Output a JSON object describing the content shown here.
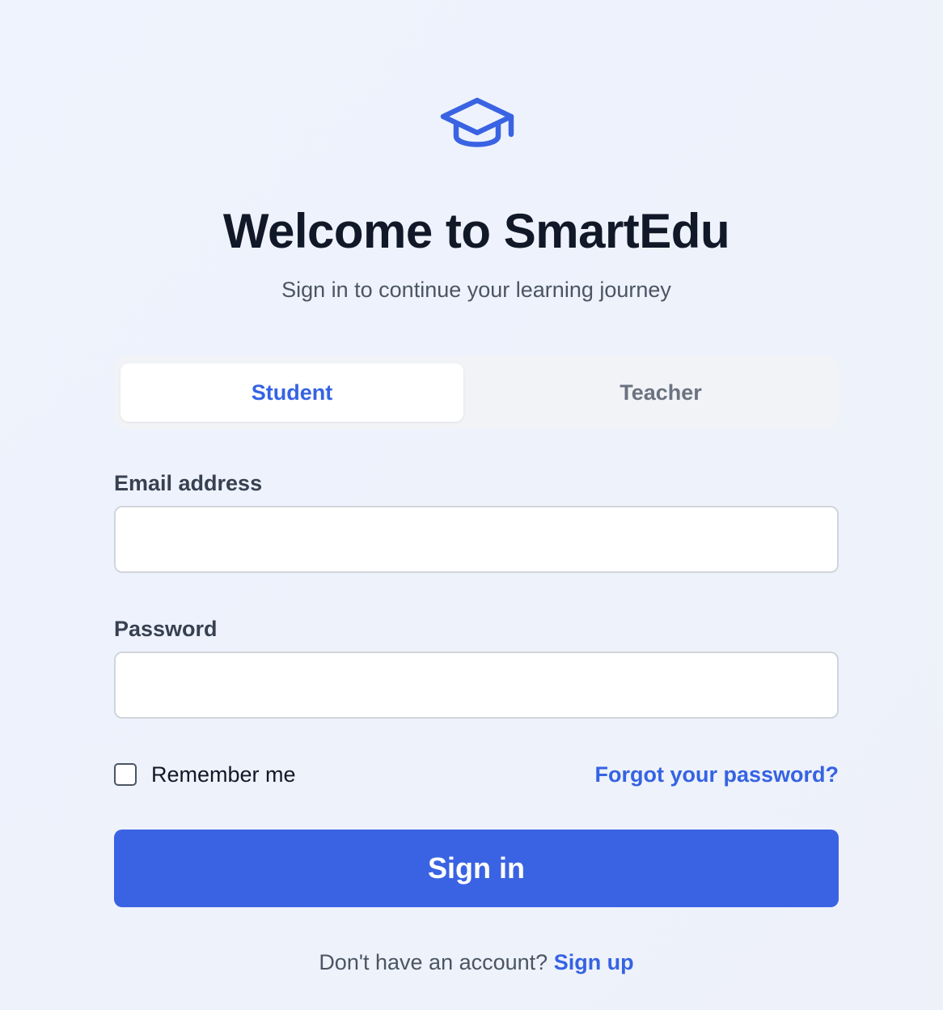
{
  "header": {
    "logo_icon": "graduation-cap-icon",
    "title": "Welcome to SmartEdu",
    "subtitle": "Sign in to continue your learning journey"
  },
  "role_tabs": {
    "active": "Student",
    "items": [
      {
        "label": "Student",
        "active": true
      },
      {
        "label": "Teacher",
        "active": false
      }
    ]
  },
  "form": {
    "email_label": "Email address",
    "email_value": "",
    "password_label": "Password",
    "password_value": "",
    "remember_label": "Remember me",
    "remember_checked": false,
    "forgot_link": "Forgot your password?",
    "submit_label": "Sign in"
  },
  "footer": {
    "prompt": "Don't have an account?",
    "signup_link": "Sign up"
  },
  "colors": {
    "accent": "#3a63e3",
    "title": "#111827",
    "muted": "#4b5563",
    "background": "#eff3fd"
  }
}
